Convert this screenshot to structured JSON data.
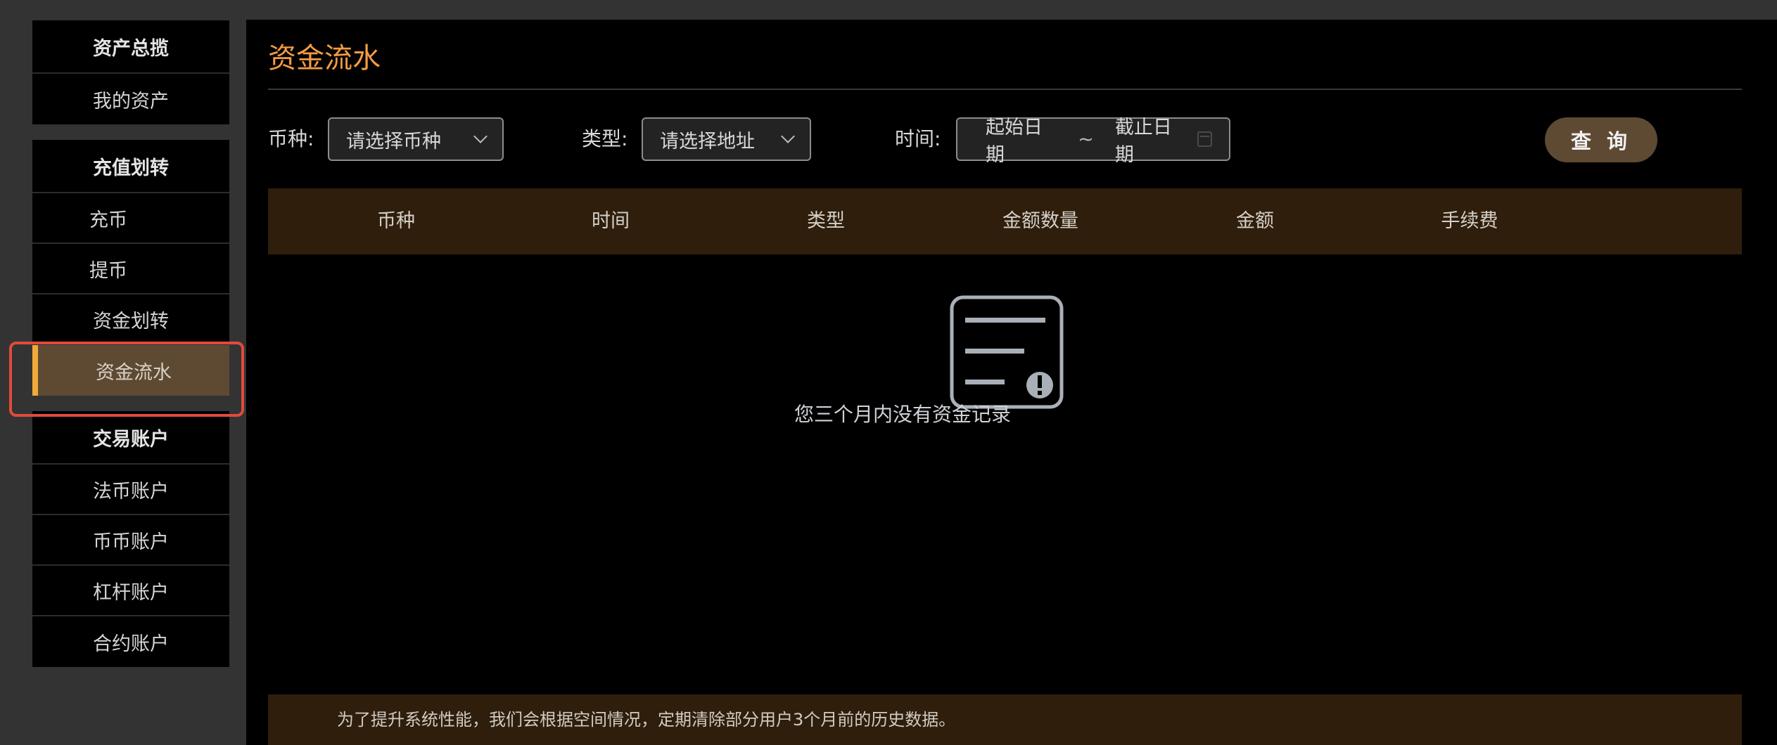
{
  "sidebar": {
    "groups": [
      {
        "header": "资产总揽",
        "items": [
          "我的资产"
        ]
      },
      {
        "header": "充值划转",
        "items": [
          "充币",
          "提币",
          "资金划转",
          "资金流水"
        ]
      },
      {
        "header": "交易账户",
        "items": [
          "法币账户",
          "币币账户",
          "杠杆账户",
          "合约账户"
        ]
      }
    ],
    "active_item": "资金流水"
  },
  "main": {
    "title": "资金流水",
    "filters": {
      "coin_label": "币种:",
      "coin_placeholder": "请选择币种",
      "type_label": "类型:",
      "type_placeholder": "请选择地址",
      "time_label": "时间:",
      "start_date": "起始日期",
      "separator": "~",
      "end_date": "截止日期",
      "query_button": "查 询"
    },
    "table": {
      "columns": [
        "币种",
        "时间",
        "类型",
        "金额数量",
        "金额",
        "手续费"
      ]
    },
    "empty_state": {
      "message": "您三个月内没有资金记录"
    },
    "notice": "为了提升系统性能，我们会根据空间情况，定期清除部分用户3个月前的历史数据。"
  },
  "colors": {
    "accent": "#f29b44",
    "active_bg": "#5e4a33",
    "active_bar": "#f0a93a",
    "highlight": "#e24a3c",
    "table_header_bg": "#2f1e0c"
  }
}
